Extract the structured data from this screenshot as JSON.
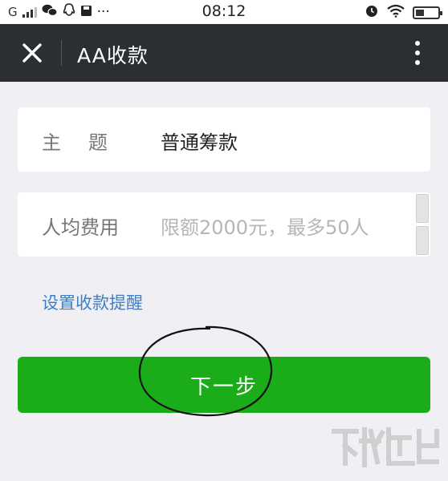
{
  "status_bar": {
    "carrier": "G",
    "time": "08:12",
    "icons_left": [
      "signal-icon",
      "wechat-icon",
      "qq-icon",
      "save-icon",
      "more-dots"
    ],
    "icons_right": [
      "alarm-icon",
      "wifi-icon",
      "battery-icon"
    ]
  },
  "titlebar": {
    "title": "AA收款"
  },
  "form": {
    "subject_label": "主题",
    "subject_value": "普通筹款",
    "amount_label": "人均费用",
    "amount_placeholder": "限额2000元，最多50人"
  },
  "reminder_link": "设置收款提醒",
  "next_button": "下一步",
  "colors": {
    "titlebar_bg": "#2b2f33",
    "page_bg": "#efeff4",
    "primary_green": "#1aad19",
    "link_blue": "#3f7fc8"
  }
}
